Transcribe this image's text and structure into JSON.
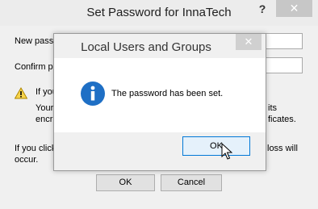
{
  "background_dialog": {
    "title": "Set Password for InnaTech",
    "help_glyph": "?",
    "close_glyph": "✕",
    "new_password_label": "New pass",
    "confirm_password_label": "Confirm pa",
    "warning_line1": "If you",
    "warning_line2": "Your",
    "warning_line3": "encr",
    "warning_right1": "its",
    "warning_right2": "ficates.",
    "footer_left1": "If you click",
    "footer_left2": "occur.",
    "footer_right": "loss will",
    "ok_label": "OK",
    "cancel_label": "Cancel"
  },
  "modal": {
    "title": "Local Users and Groups",
    "close_glyph": "✕",
    "message": "The password has been set.",
    "ok_label": "OK",
    "icon": "info-icon",
    "accent_color": "#1e6fc5"
  }
}
